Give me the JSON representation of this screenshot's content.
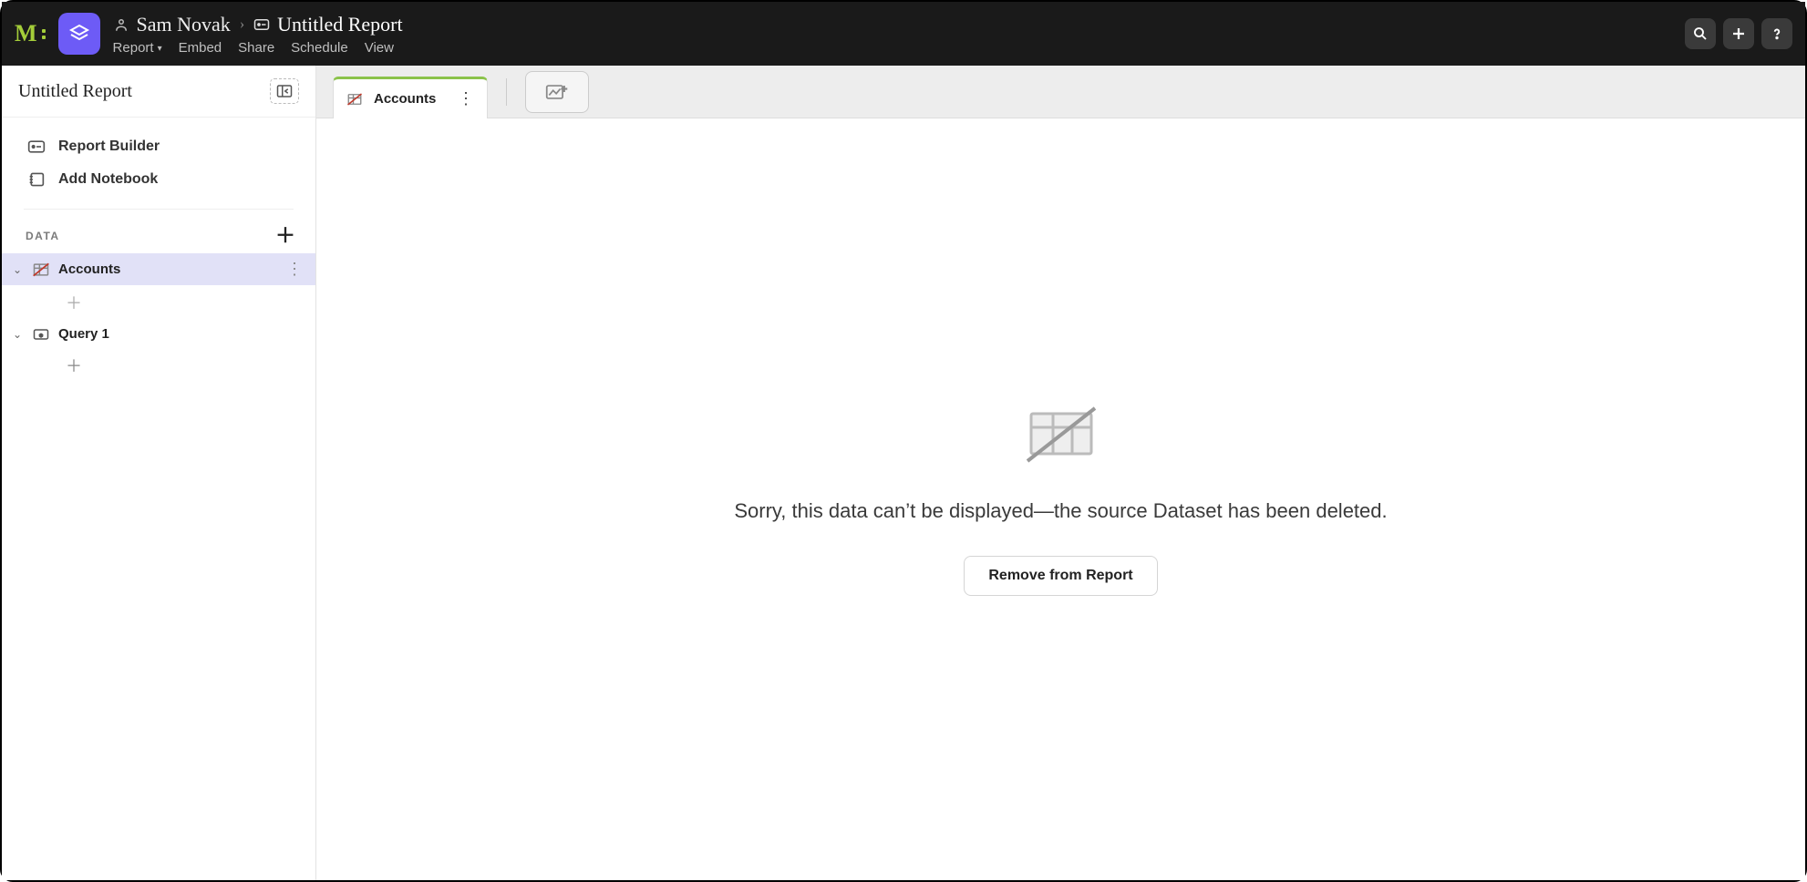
{
  "header": {
    "workspace": "Sam Novak",
    "report_title": "Untitled Report",
    "menu": {
      "report": "Report",
      "embed": "Embed",
      "share": "Share",
      "schedule": "Schedule",
      "view": "View"
    }
  },
  "sidebar": {
    "title": "Untitled Report",
    "links": {
      "report_builder": "Report Builder",
      "add_notebook": "Add Notebook"
    },
    "data_label": "DATA",
    "items": [
      {
        "label": "Accounts",
        "type": "dataset-broken",
        "selected": true
      },
      {
        "label": "Query 1",
        "type": "query",
        "selected": false
      }
    ]
  },
  "tabs": {
    "active": {
      "label": "Accounts"
    }
  },
  "empty_state": {
    "message": "Sorry, this data can’t be displayed—the source Dataset has been deleted.",
    "button": "Remove from Report"
  }
}
